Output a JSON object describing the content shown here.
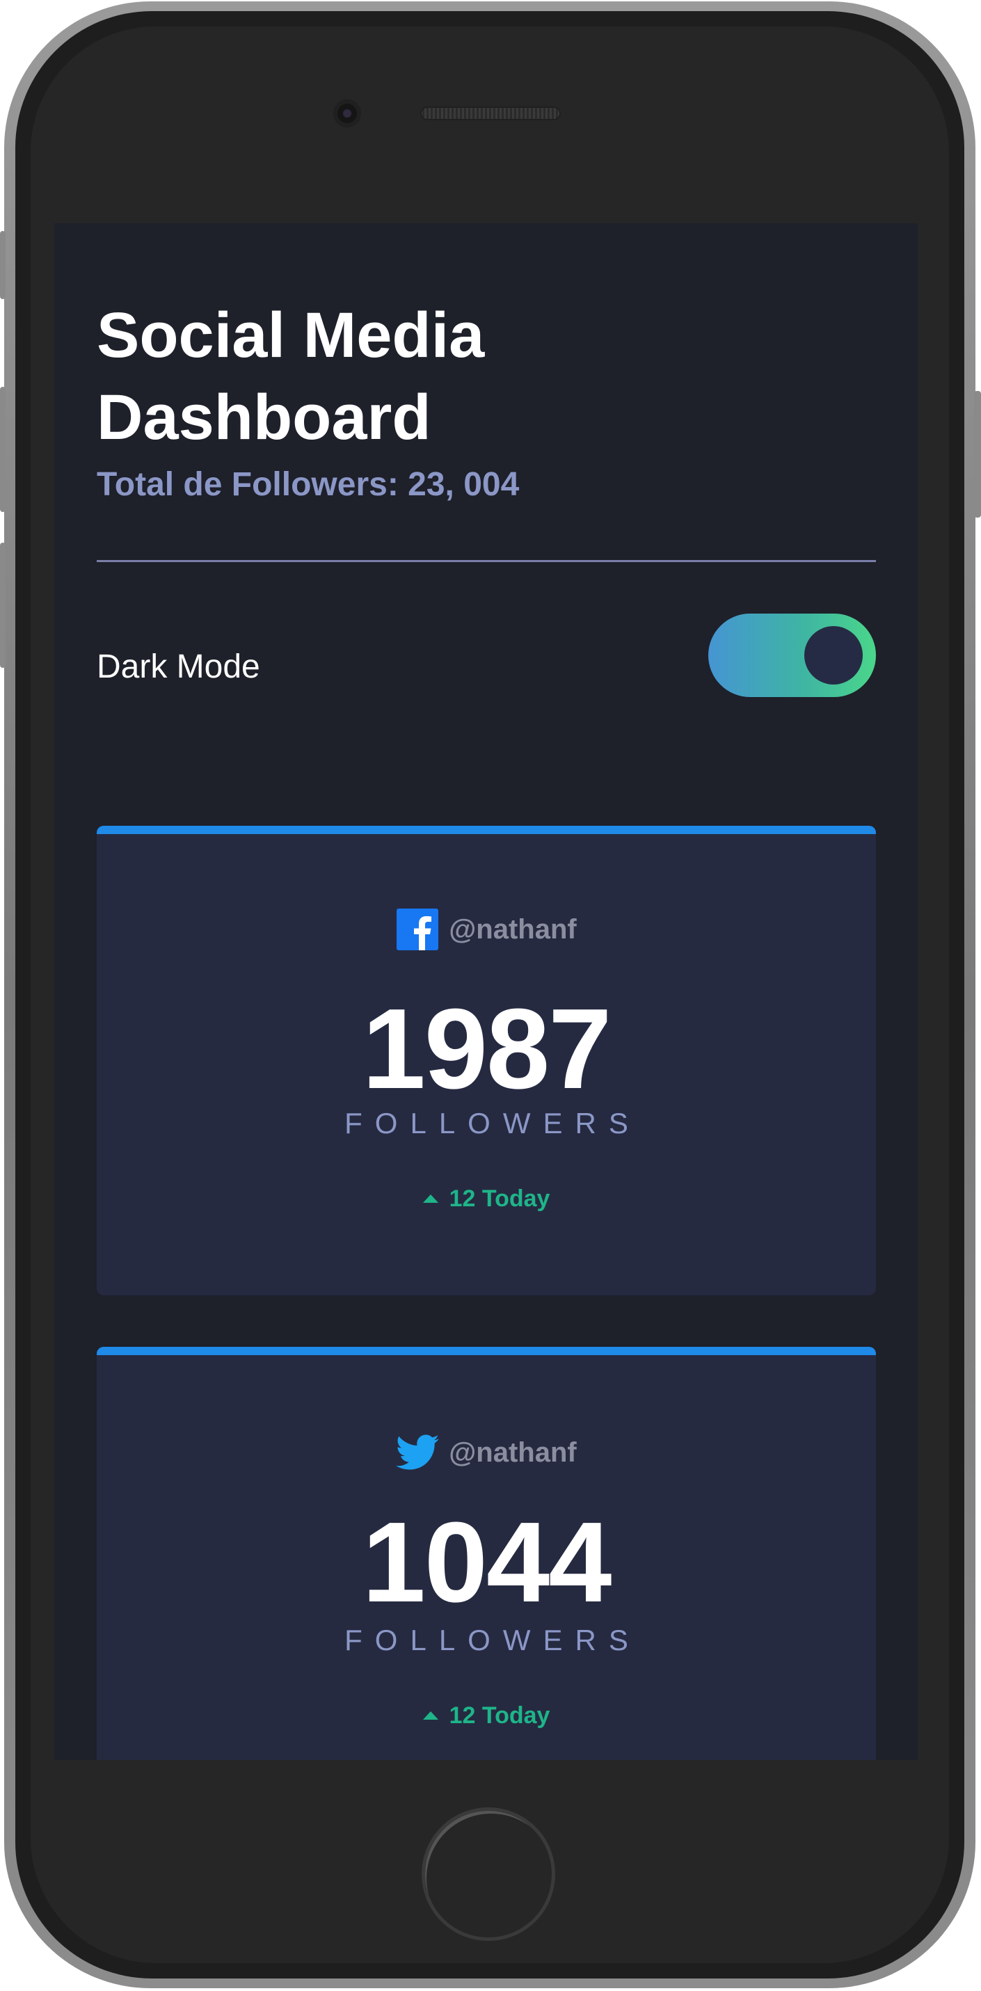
{
  "dashboard": {
    "title": "Social Media Dashboard",
    "total_followers": "Total de Followers: 23, 004",
    "mode_label": "Dark Mode",
    "dark_mode_on": true
  },
  "cards": [
    {
      "platform_icon": "facebook-icon",
      "handle": "@nathanf",
      "count": "1987",
      "count_label": "FOLLOWERS",
      "today": "12 Today",
      "accent": "#1f8ae8"
    },
    {
      "platform_icon": "twitter-icon",
      "handle": "@nathanf",
      "count": "1044",
      "count_label": "FOLLOWERS",
      "today": "12 Today",
      "accent": "#1da1f2"
    }
  ],
  "colors": {
    "background": "#1e202a",
    "card": "#252a41",
    "up_green": "#1eb589",
    "muted_text": "#8b97c6",
    "toggle_gradient": [
      "#4595d3",
      "#4ad68a"
    ]
  }
}
